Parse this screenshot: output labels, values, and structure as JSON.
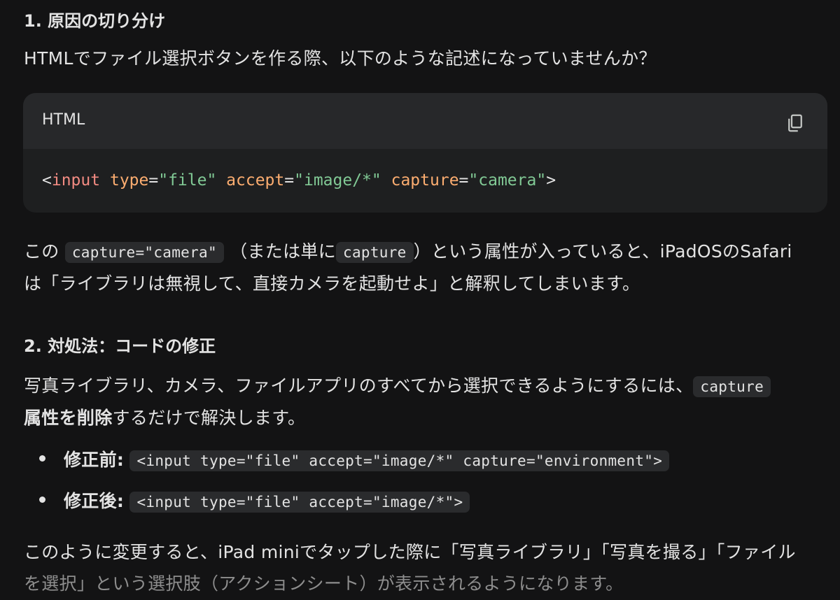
{
  "section1": {
    "heading": "1. 原因の切り分け",
    "intro": "HTMLでファイル選択ボタンを作る際、以下のような記述になっていませんか？"
  },
  "codeblock": {
    "language": "HTML",
    "copy_icon": "copy-icon",
    "tokens": {
      "lt": "<",
      "tag": "input",
      "attr1": "type",
      "eq1": "=",
      "val1": "\"file\"",
      "attr2": "accept",
      "eq2": "=",
      "val2": "\"image/*\"",
      "attr3": "capture",
      "eq3": "=",
      "val3": "\"camera\"",
      "gt": ">"
    }
  },
  "explain": {
    "part1": "この",
    "code1": "capture=\"camera\"",
    "part2": "（または単に",
    "code2": "capture",
    "part3": "）という属性が入っていると、iPadOSのSafari",
    "line2": "は「ライブラリは無視して、直接カメラを起動せよ」と解釈してしまいます。"
  },
  "section2": {
    "heading": "2. 対処法：コードの修正",
    "line1_text": "写真ライブラリ、カメラ、ファイルアプリのすべてから選択できるようにするには、",
    "line1_code": "capture",
    "line2_bold": "属性を削除",
    "line2_rest": "するだけで解決します。"
  },
  "bullets": [
    {
      "label": "修正前:",
      "code": "<input type=\"file\" accept=\"image/*\" capture=\"environment\">"
    },
    {
      "label": "修正後:",
      "code": "<input type=\"file\" accept=\"image/*\">"
    }
  ],
  "conclusion": {
    "line1": "このように変更すると、iPad miniでタップした際に「写真ライブラリ」「写真を撮る」「ファイル",
    "line2": "を選択」という選択肢（アクションシート）が表示されるようになります。"
  }
}
